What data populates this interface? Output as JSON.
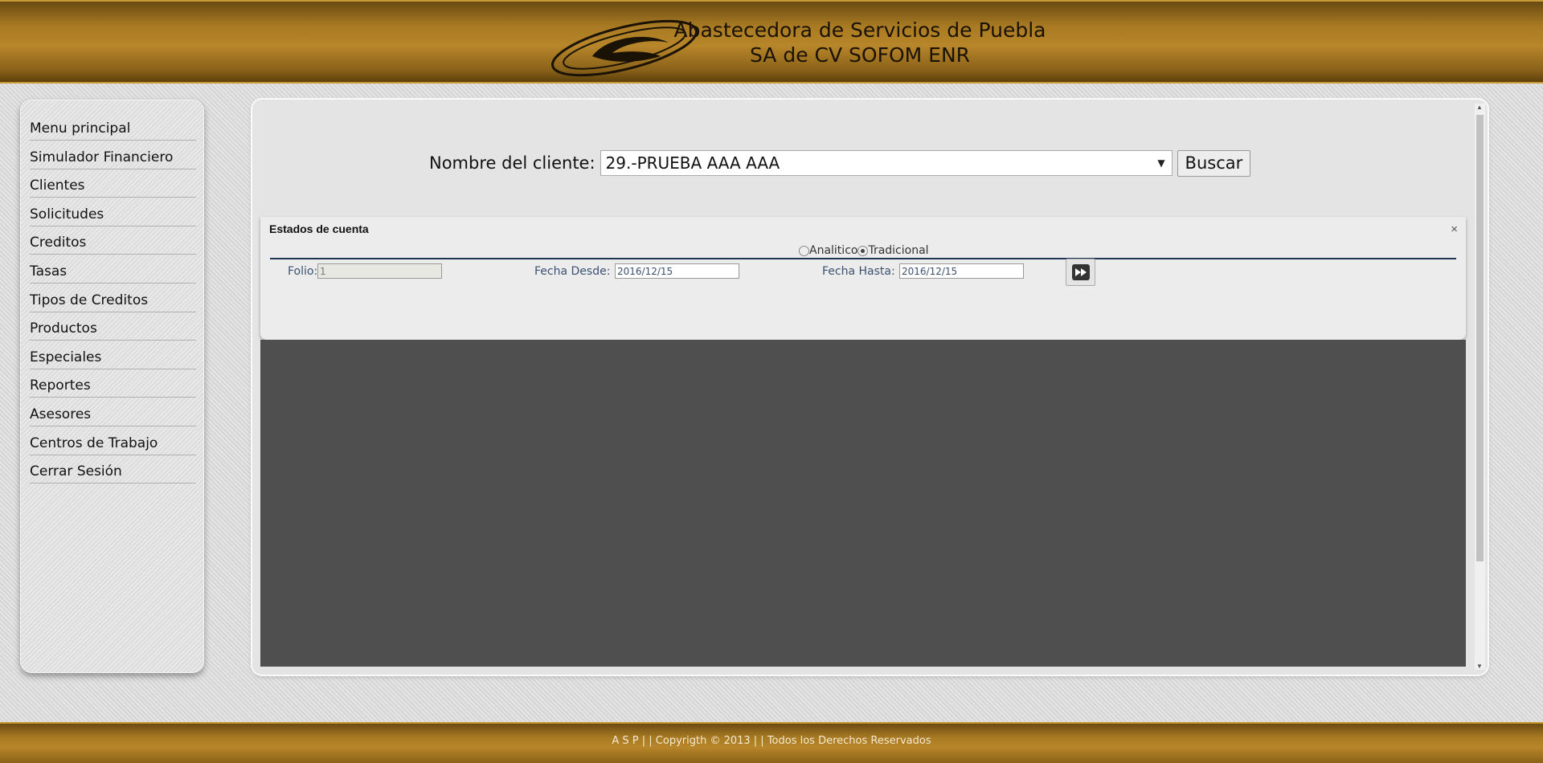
{
  "header": {
    "title_line1": "Abastecedora de Servicios de Puebla",
    "title_line2": "SA de CV SOFOM ENR"
  },
  "sidebar": {
    "items": [
      {
        "label": "Menu principal"
      },
      {
        "label": "Simulador Financiero"
      },
      {
        "label": "Clientes"
      },
      {
        "label": "Solicitudes"
      },
      {
        "label": "Creditos"
      },
      {
        "label": "Tasas"
      },
      {
        "label": "Tipos de Creditos"
      },
      {
        "label": "Productos"
      },
      {
        "label": "Especiales"
      },
      {
        "label": "Reportes"
      },
      {
        "label": "Asesores"
      },
      {
        "label": "Centros de Trabajo"
      },
      {
        "label": "Cerrar Sesión"
      }
    ]
  },
  "search": {
    "label": "Nombre del cliente:",
    "selected_client": "29.-PRUEBA AAA AAA",
    "button_label": "Buscar"
  },
  "dialog": {
    "title": "Estados de cuenta",
    "close_symbol": "×",
    "radio_options": [
      {
        "label": "Analitico",
        "checked": false
      },
      {
        "label": "Tradicional",
        "checked": true
      }
    ],
    "folio_label": "Folio:",
    "folio_value": "1",
    "fecha_desde_label": "Fecha Desde:",
    "fecha_desde_value": "2016/12/15",
    "fecha_hasta_label": "Fecha Hasta:",
    "fecha_hasta_value": "2016/12/15",
    "go_icon": "fast-forward-icon"
  },
  "footer": {
    "text": "A S P  | |  Copyrigth © 2013  | |  Todos los Derechos Reservados"
  },
  "colors": {
    "header_gold": "#b8862a",
    "overlay": "#4f4f4f",
    "rule": "#1f3556",
    "label_blue": "#3c5170"
  }
}
